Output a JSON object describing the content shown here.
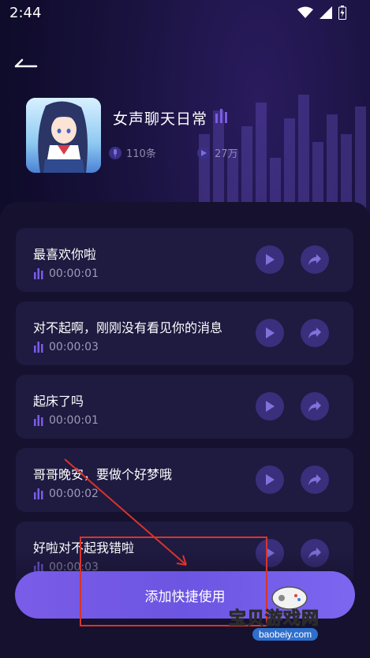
{
  "status_bar": {
    "time": "2:44"
  },
  "header": {
    "back_icon": "back-arrow-icon",
    "album_title": "女声聊天日常",
    "count_text": "110条",
    "plays_text": "27万"
  },
  "items": [
    {
      "title": "最喜欢你啦",
      "duration": "00:00:01"
    },
    {
      "title": "对不起啊，刚刚没有看见你的消息",
      "duration": "00:00:03"
    },
    {
      "title": "起床了吗",
      "duration": "00:00:01"
    },
    {
      "title": "哥哥晚安，要做个好梦哦",
      "duration": "00:00:02"
    },
    {
      "title": "好啦对不起我错啦",
      "duration": "00:00:03"
    }
  ],
  "cta": {
    "label": "添加快捷使用"
  },
  "watermark": {
    "text": "宝贝游戏网",
    "subtext": "baobeiy.com"
  },
  "colors": {
    "accent": "#7a5ce8",
    "background": "#15112f",
    "card": "#1f1a40",
    "annotation": "#d9342b"
  }
}
